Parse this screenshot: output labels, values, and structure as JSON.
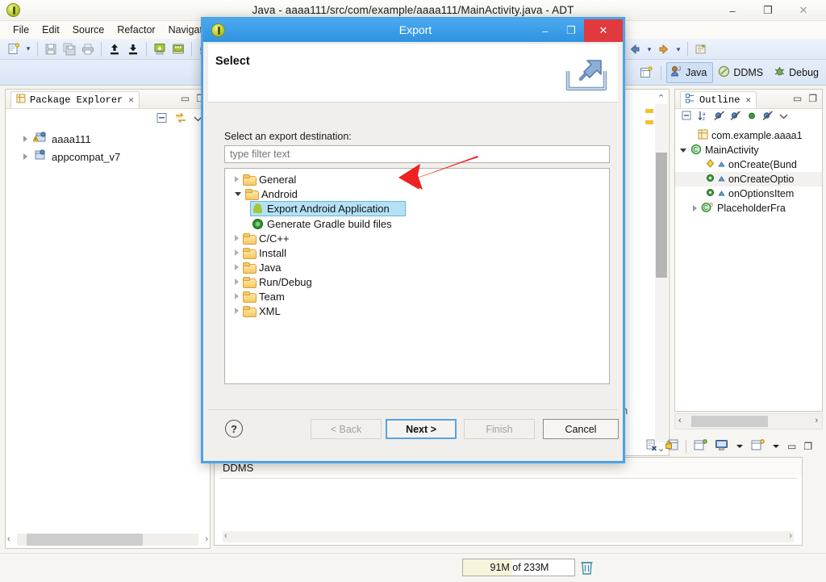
{
  "window": {
    "title": "Java - aaaa111/src/com/example/aaaa111/MainActivity.java - ADT",
    "app_icon": "eclipse-icon",
    "controls": {
      "minimize": "–",
      "maximize": "❐",
      "close": "✕"
    }
  },
  "menubar": {
    "items": [
      {
        "label": "File"
      },
      {
        "label": "Edit"
      },
      {
        "label": "Source"
      },
      {
        "label": "Refactor"
      },
      {
        "label": "Navigate"
      }
    ]
  },
  "perspective": {
    "tabs": [
      {
        "label": "Java",
        "active": true,
        "icon": "java-perspective-icon"
      },
      {
        "label": "DDMS",
        "active": false,
        "icon": "ddms-perspective-icon"
      },
      {
        "label": "Debug",
        "active": false,
        "icon": "debug-perspective-icon"
      }
    ],
    "open_perspective": "open-perspective-icon"
  },
  "package_explorer": {
    "title": "Package Explorer",
    "close_glyph": "✕",
    "minimize_glyph": "▭",
    "maximize_glyph": "❐",
    "toolbar": [
      {
        "icon": "collapse-all-icon"
      },
      {
        "icon": "link-with-editor-icon"
      },
      {
        "icon": "view-menu-icon"
      }
    ],
    "items": [
      {
        "label": "aaaa111",
        "icon": "java-project-warning-icon",
        "expandable": true
      },
      {
        "label": "appcompat_v7",
        "icon": "java-project-icon",
        "expandable": true
      }
    ]
  },
  "outline": {
    "title": "Outline",
    "close_glyph": "✕",
    "minimize_glyph": "▭",
    "maximize_glyph": "❐",
    "toolbar": [
      {
        "icon": "collapse-all-icon"
      },
      {
        "icon": "sort-alphabetically-icon"
      },
      {
        "icon": "hide-fields-icon"
      },
      {
        "icon": "hide-static-icon"
      },
      {
        "icon": "hide-nonpublic-icon"
      },
      {
        "icon": "hide-local-types-icon"
      },
      {
        "icon": "view-menu-icon"
      }
    ],
    "items": [
      {
        "label": "com.example.aaaa1",
        "icon": "package-icon",
        "indent": 1,
        "expandable": false,
        "selected": false
      },
      {
        "label": "MainActivity",
        "icon": "class-icon",
        "indent": 0,
        "expandable": true,
        "expanded": true,
        "selected": false
      },
      {
        "label": "onCreate(Bund",
        "icon": "method-protected-icon",
        "indent": 2,
        "expandable": false,
        "selected": false
      },
      {
        "label": "onCreateOptio",
        "icon": "method-public-icon",
        "indent": 2,
        "expandable": false,
        "selected": true
      },
      {
        "label": "onOptionsItem",
        "icon": "method-public-icon",
        "indent": 2,
        "expandable": false,
        "selected": false
      },
      {
        "label": "PlaceholderFra",
        "icon": "class-static-icon",
        "indent": 1,
        "expandable": true,
        "selected": false
      }
    ]
  },
  "ddms_panel": {
    "tab_label": "DDMS"
  },
  "editor_toolbar_bottom": [
    {
      "icon": "remove-icon"
    },
    {
      "icon": "lock-icon"
    },
    {
      "icon": "new-editor-icon"
    },
    {
      "icon": "display-icon"
    },
    {
      "icon": "display-dropdown-icon"
    },
    {
      "icon": "new-wizard-icon"
    },
    {
      "icon": "new-wizard-dropdown-icon"
    },
    {
      "icon": "minimize-icon"
    },
    {
      "icon": "maximize-icon"
    }
  ],
  "main_toolbar": [
    {
      "icon": "new-wizard-icon"
    },
    {
      "icon": "new-wizard-dropdown-icon"
    },
    {
      "icon": "save-icon"
    },
    {
      "icon": "save-all-icon"
    },
    {
      "icon": "print-icon"
    },
    {
      "icon": "export-icon"
    },
    {
      "icon": "import-icon"
    },
    {
      "icon": "android-sdk-manager-icon"
    },
    {
      "icon": "android-avd-manager-icon"
    },
    {
      "icon": "skip-breakpoints-icon"
    },
    {
      "icon": "back-icon"
    },
    {
      "icon": "back-dropdown-icon"
    },
    {
      "icon": "forward-icon"
    },
    {
      "icon": "forward-dropdown-icon"
    },
    {
      "icon": "open-type-icon"
    }
  ],
  "statusbar": {
    "heap_text": "91M of 233M",
    "heap_percent": 39,
    "trash_icon": "trash-icon"
  },
  "dialog": {
    "title": "Export",
    "icon": "eclipse-icon",
    "controls": {
      "minimize": "–",
      "maximize": "❐",
      "close": "✕"
    },
    "header_title": "Select",
    "header_icon": "export-wizard-icon",
    "destination_label": "Select an export destination:",
    "filter_placeholder": "type filter text",
    "filter_value": "",
    "tree": [
      {
        "label": "General",
        "icon": "folder-icon",
        "indent": 0,
        "expandable": true,
        "expanded": false,
        "selected": false
      },
      {
        "label": "Android",
        "icon": "folder-icon",
        "indent": 0,
        "expandable": true,
        "expanded": true,
        "selected": false
      },
      {
        "label": "Export Android Application",
        "icon": "android-icon",
        "indent": 1,
        "expandable": false,
        "expanded": false,
        "selected": true
      },
      {
        "label": "Generate Gradle build files",
        "icon": "gradle-icon",
        "indent": 1,
        "expandable": false,
        "expanded": false,
        "selected": false
      },
      {
        "label": "C/C++",
        "icon": "folder-icon",
        "indent": 0,
        "expandable": true,
        "expanded": false,
        "selected": false
      },
      {
        "label": "Install",
        "icon": "folder-icon",
        "indent": 0,
        "expandable": true,
        "expanded": false,
        "selected": false
      },
      {
        "label": "Java",
        "icon": "folder-icon",
        "indent": 0,
        "expandable": true,
        "expanded": false,
        "selected": false
      },
      {
        "label": "Run/Debug",
        "icon": "folder-icon",
        "indent": 0,
        "expandable": true,
        "expanded": false,
        "selected": false
      },
      {
        "label": "Team",
        "icon": "folder-icon",
        "indent": 0,
        "expandable": true,
        "expanded": false,
        "selected": false
      },
      {
        "label": "XML",
        "icon": "folder-icon",
        "indent": 0,
        "expandable": true,
        "expanded": false,
        "selected": false
      }
    ],
    "help_glyph": "?",
    "buttons": {
      "back": "< Back",
      "next": "Next >",
      "finish": "Finish",
      "cancel": "Cancel"
    }
  },
  "annotation": {
    "arrow_color": "#ee2222",
    "type": "red-arrow-pointing-to-selected-item"
  },
  "colors": {
    "dialog_border": "#4aa3e8",
    "titlebar_blue": "#3094e0",
    "close_red": "#e0393e",
    "selection_blue": "#b5e1f5",
    "accent_android_green": "#a4c639"
  }
}
